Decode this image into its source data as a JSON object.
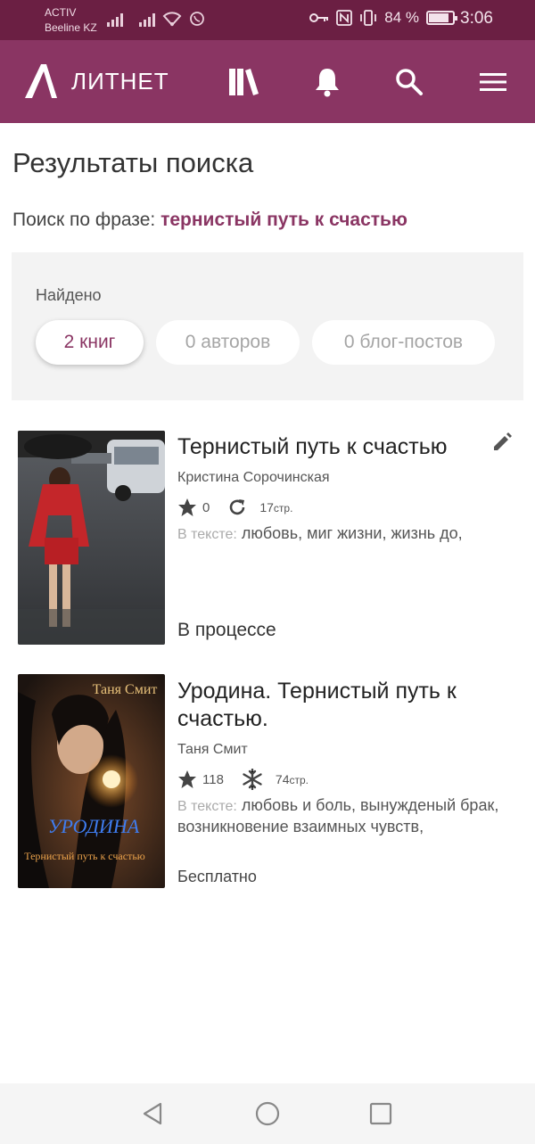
{
  "status_bar": {
    "carrier_line1": "ACTIV",
    "carrier_line2": "Beeline KZ",
    "battery_percent": "84 %",
    "battery_level": 0.84,
    "time": "3:06"
  },
  "header": {
    "logo_text": "ЛИТНЕТ",
    "icons": [
      "library-icon",
      "bell-icon",
      "search-icon",
      "menu-icon"
    ]
  },
  "page": {
    "title": "Результаты поиска",
    "phrase_label": "Поиск по фразе:",
    "phrase_value": "тернистый путь к счастью"
  },
  "found": {
    "label": "Найдено",
    "tabs": [
      {
        "label": "2 книг",
        "active": true
      },
      {
        "label": "0 авторов",
        "active": false
      },
      {
        "label": "0 блог-постов",
        "active": false
      }
    ]
  },
  "books": [
    {
      "title": "Тернистый путь к счастью",
      "author": "Кристина Сорочинская",
      "rating": "0",
      "pages": "17",
      "pages_unit": "стр.",
      "tags_label": "В тексте:",
      "tags": "любовь, миг жизни, жизнь до,",
      "status": "В процессе"
    },
    {
      "title": "Уродина. Тернистый путь к счастью.",
      "author": "Таня Смит",
      "rating": "118",
      "pages": "74",
      "pages_unit": "стр.",
      "tags_label": "В тексте:",
      "tags": "любовь и боль, вынужденый брак, возникновение взаимных чувств,",
      "status": "Бесплатно",
      "cover_author": "Таня Смит",
      "cover_title": "УРОДИНА",
      "cover_subtitle": "Тернистый путь к счастью"
    }
  ],
  "colors": {
    "status_bar": "#6b1f43",
    "header": "#8a3563",
    "accent": "#8a3563"
  }
}
